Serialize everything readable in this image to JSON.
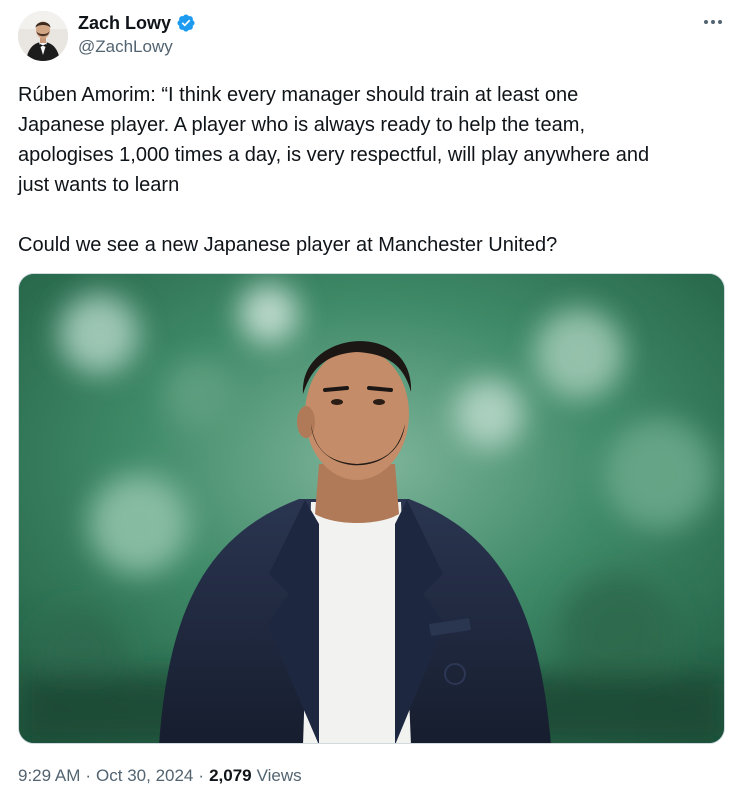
{
  "author": {
    "display_name": "Zach Lowy",
    "handle": "@ZachLowy",
    "verified": true,
    "avatar_icon": "avatar-man-tuxedo"
  },
  "more_icon": "more-horizontal-icon",
  "tweet": {
    "text": "Rúben Amorim: “I think every manager should train at least one\nJapanese player. A player who is always ready to help the team,\napologises 1,000 times a day, is very respectful, will play anywhere and\njust wants to learn\n\nCould we see a new Japanese player at Manchester United?"
  },
  "media": {
    "kind": "photo"
  },
  "meta": {
    "time": "9:29 AM",
    "separator": "·",
    "date": "Oct 30, 2024",
    "separator2": "·",
    "views_count": "2,079",
    "views_label": "Views"
  },
  "colors": {
    "text_primary": "#0f1419",
    "text_secondary": "#536471",
    "verified_blue": "#1d9bf0",
    "border": "#cfd9de"
  }
}
